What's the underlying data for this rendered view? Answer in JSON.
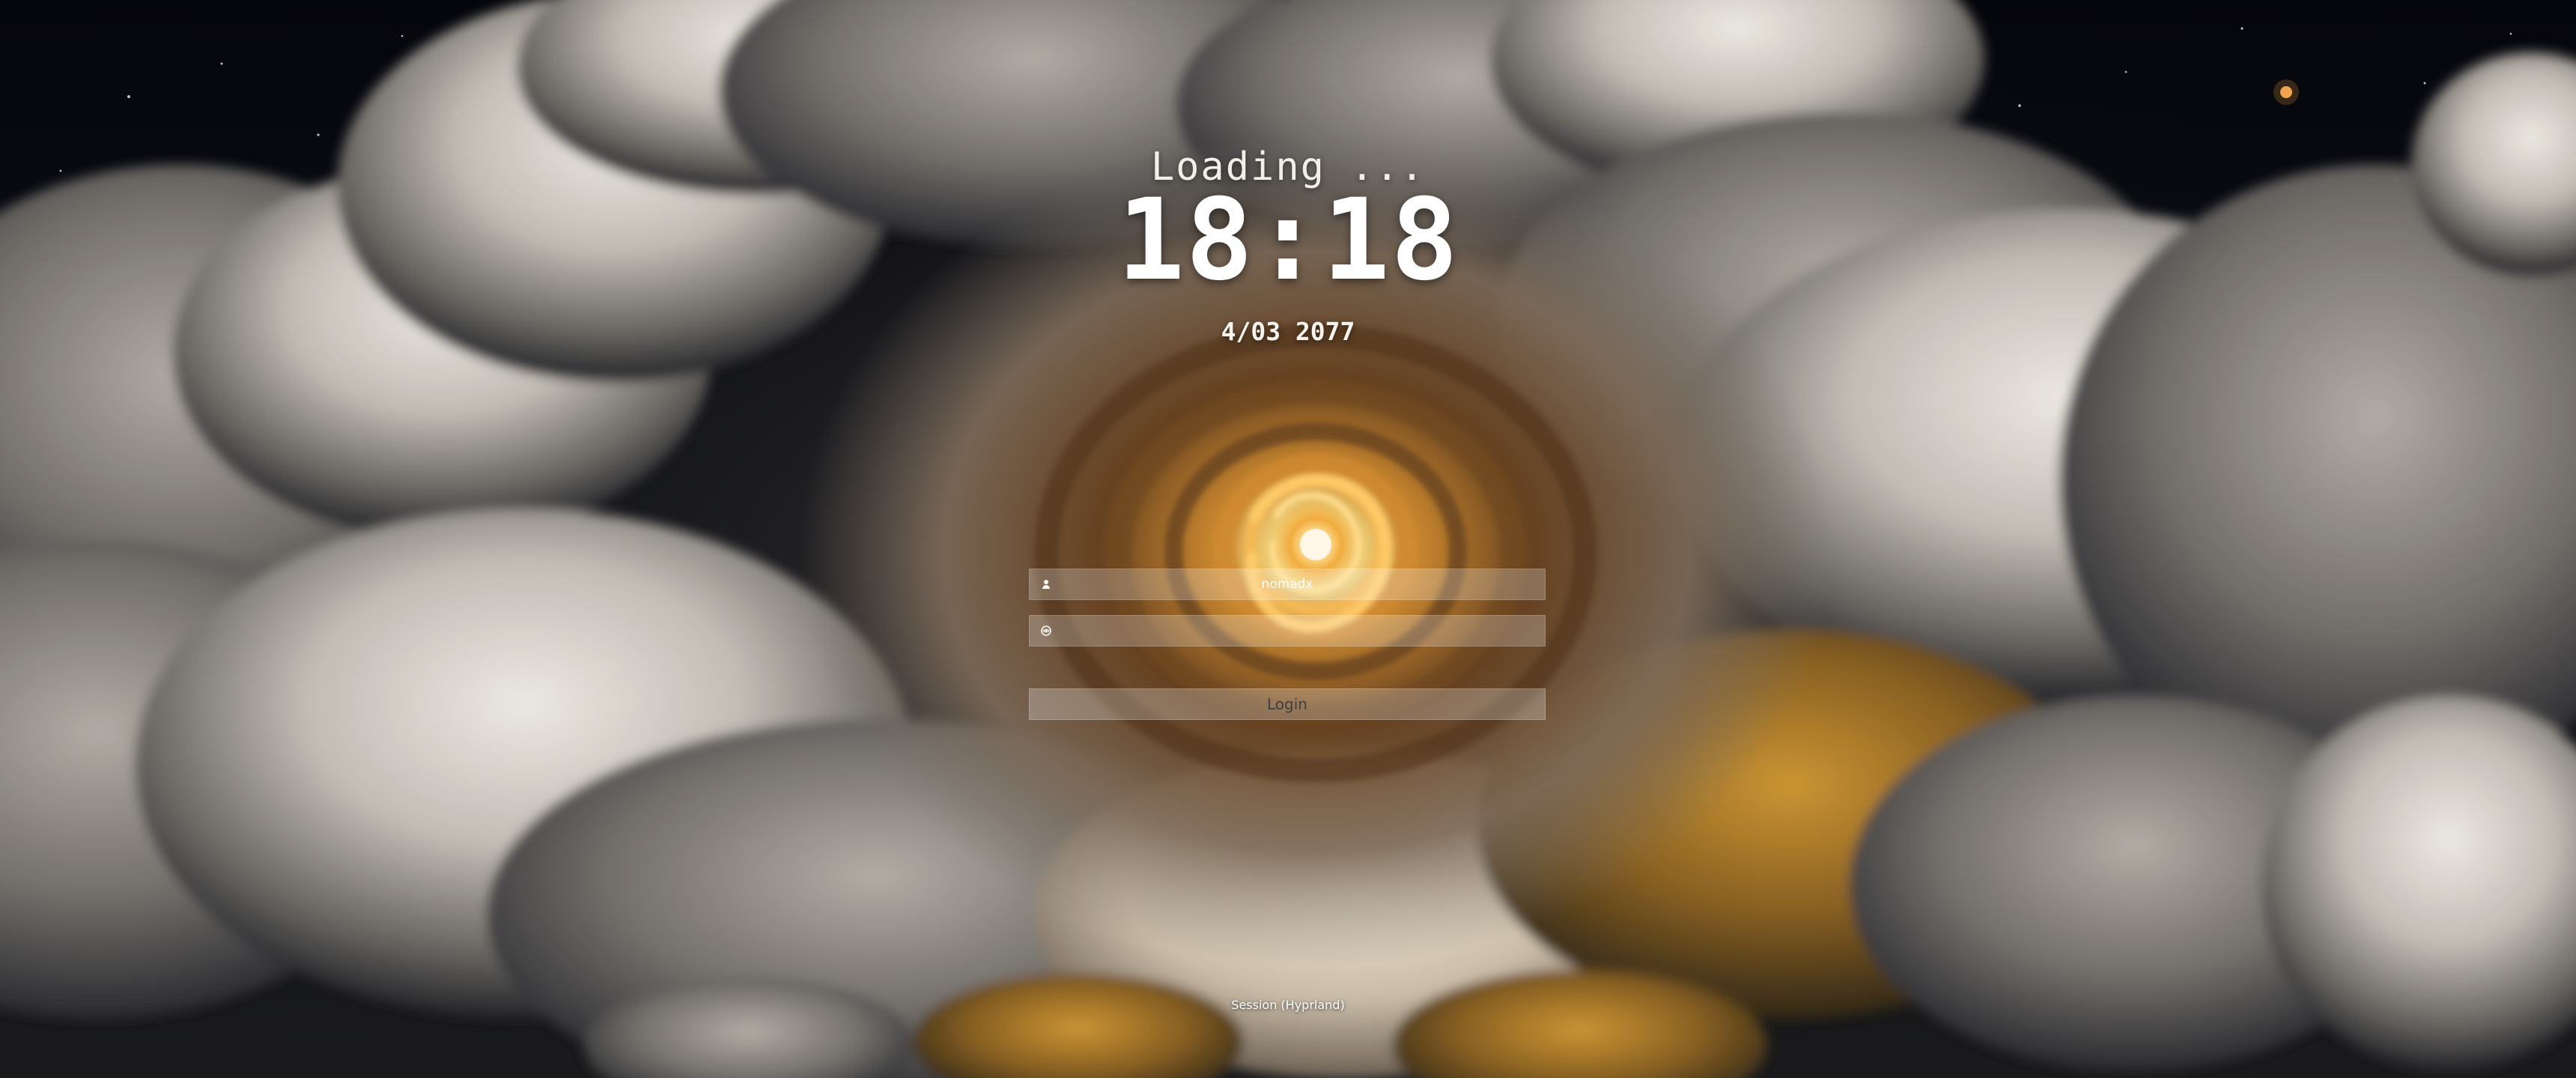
{
  "greeter": {
    "status_text": "Loading ...",
    "time": "18:18",
    "date": "4/03 2077"
  },
  "login": {
    "username_value": "nomadx",
    "password_placeholder": "",
    "button_label": "Login",
    "username_icon": "user-icon",
    "password_icon": "eye-icon"
  },
  "session": {
    "label": "Session (Hyprland)"
  },
  "colors": {
    "vortex_glow": "#f2b24a",
    "vortex_core": "#fff3d3",
    "field_fill": "#d7d3cf",
    "text": "#ffffff"
  }
}
